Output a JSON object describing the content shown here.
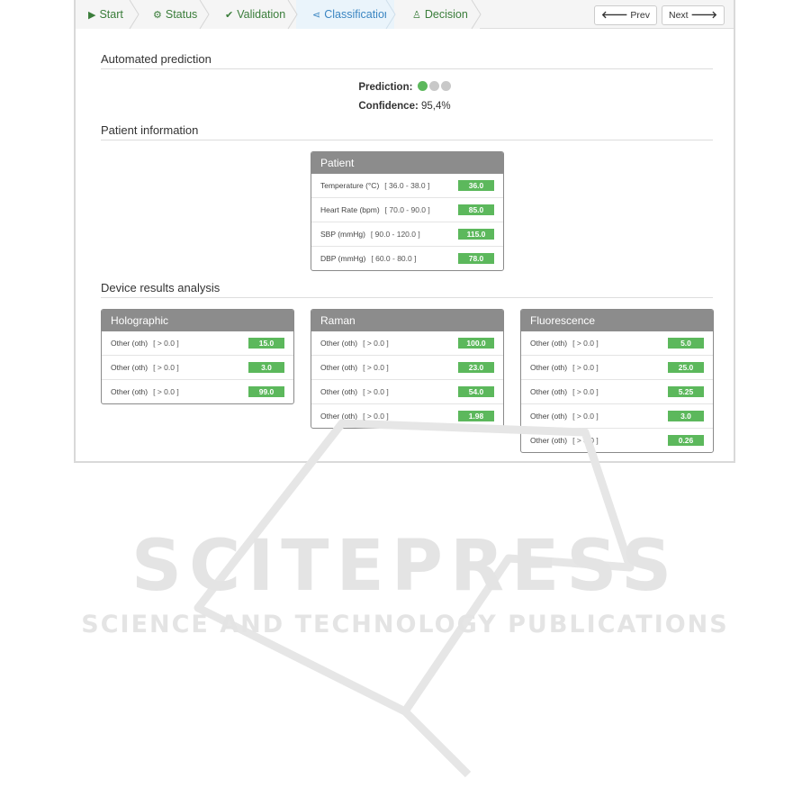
{
  "wizard": {
    "steps": [
      {
        "label": "Start",
        "icon": "play-circle-icon"
      },
      {
        "label": "Status",
        "icon": "gears-icon"
      },
      {
        "label": "Validation",
        "icon": "check-circle-icon"
      },
      {
        "label": "Classification",
        "icon": "share-icon"
      },
      {
        "label": "Decision",
        "icon": "user-md-icon"
      }
    ],
    "active_step": "Classification",
    "prev_label": "Prev",
    "next_label": "Next"
  },
  "prediction": {
    "section_title": "Automated prediction",
    "prediction_label": "Prediction:",
    "dots_total": 3,
    "dots_active": 1,
    "confidence_label": "Confidence:",
    "confidence_value": "95,4%"
  },
  "patient": {
    "section_title": "Patient information",
    "panel_title": "Patient",
    "rows": [
      {
        "label": "Temperature (°C)",
        "range": "[ 36.0 - 38.0 ]",
        "value": "36.0"
      },
      {
        "label": "Heart Rate (bpm)",
        "range": "[ 70.0 - 90.0 ]",
        "value": "85.0"
      },
      {
        "label": "SBP (mmHg)",
        "range": "[ 90.0 - 120.0 ]",
        "value": "115.0"
      },
      {
        "label": "DBP (mmHg)",
        "range": "[ 60.0 - 80.0 ]",
        "value": "78.0"
      }
    ]
  },
  "devices": {
    "section_title": "Device results analysis",
    "panels": [
      {
        "title": "Holographic",
        "rows": [
          {
            "label": "Other (oth)",
            "range": "[ > 0.0 ]",
            "value": "15.0"
          },
          {
            "label": "Other (oth)",
            "range": "[ > 0.0 ]",
            "value": "3.0"
          },
          {
            "label": "Other (oth)",
            "range": "[ > 0.0 ]",
            "value": "99.0"
          }
        ]
      },
      {
        "title": "Raman",
        "rows": [
          {
            "label": "Other (oth)",
            "range": "[ > 0.0 ]",
            "value": "100.0"
          },
          {
            "label": "Other (oth)",
            "range": "[ > 0.0 ]",
            "value": "23.0"
          },
          {
            "label": "Other (oth)",
            "range": "[ > 0.0 ]",
            "value": "54.0"
          },
          {
            "label": "Other (oth)",
            "range": "[ > 0.0 ]",
            "value": "1.98"
          }
        ]
      },
      {
        "title": "Fluorescence",
        "rows": [
          {
            "label": "Other (oth)",
            "range": "[ > 0.0 ]",
            "value": "5.0"
          },
          {
            "label": "Other (oth)",
            "range": "[ > 0.0 ]",
            "value": "25.0"
          },
          {
            "label": "Other (oth)",
            "range": "[ > 0.0 ]",
            "value": "5.25"
          },
          {
            "label": "Other (oth)",
            "range": "[ > 0.0 ]",
            "value": "3.0"
          },
          {
            "label": "Other (oth)",
            "range": "[ > 0.0 ]",
            "value": "0.26"
          }
        ]
      }
    ]
  },
  "watermark": {
    "line1": "SCITEPRESS",
    "line2": "SCIENCE AND TECHNOLOGY PUBLICATIONS"
  },
  "colors": {
    "accent_green": "#5cb85c",
    "step_green": "#3a7d3a",
    "active_blue": "#3b86c2",
    "panel_header": "#8c8c8c"
  }
}
